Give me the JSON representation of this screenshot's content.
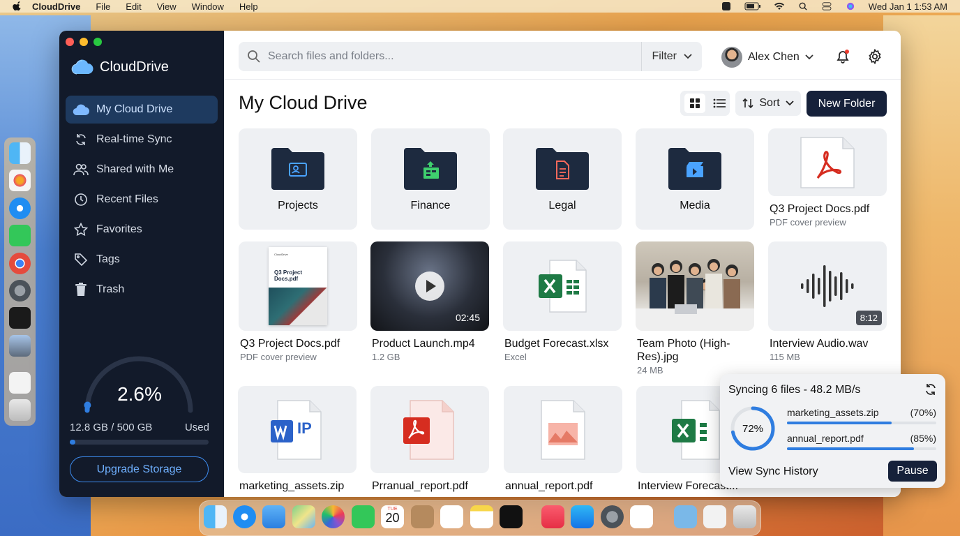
{
  "menubar": {
    "app_name": "CloudDrive",
    "menus": [
      "File",
      "Edit",
      "View",
      "Window",
      "Help"
    ],
    "clock": "Wed Jan 1  1:53 AM"
  },
  "sidebar": {
    "brand": "CloudDrive",
    "items": [
      {
        "label": "My Cloud Drive",
        "icon": "cloud-icon",
        "active": true
      },
      {
        "label": "Real-time Sync",
        "icon": "sync-icon"
      },
      {
        "label": "Shared with Me",
        "icon": "users-icon"
      },
      {
        "label": "Recent Files",
        "icon": "clock-icon"
      },
      {
        "label": "Favorites",
        "icon": "star-icon"
      },
      {
        "label": "Tags",
        "icon": "tag-icon"
      },
      {
        "label": "Trash",
        "icon": "trash-icon"
      }
    ],
    "storage": {
      "percent": "2.6%",
      "percent_value": 2.6,
      "used": "12.8 GB",
      "separator": "/",
      "total": "500 GB",
      "used_label": "Used",
      "upgrade_label": "Upgrade Storage"
    }
  },
  "header": {
    "search_placeholder": "Search files and folders...",
    "filter_label": "Filter",
    "user_name": "Alex Chen"
  },
  "main": {
    "title": "My Cloud Drive",
    "sort_label": "Sort",
    "new_folder_label": "New Folder",
    "folders": [
      {
        "name": "Projects",
        "icon": "folder-person-icon",
        "accent": "#4aa3ff"
      },
      {
        "name": "Finance",
        "icon": "folder-finance-icon",
        "accent": "#3fcf6e"
      },
      {
        "name": "Legal",
        "icon": "folder-document-icon",
        "accent": "#ff6a5c"
      },
      {
        "name": "Media",
        "icon": "folder-media-icon",
        "accent": "#4aa3ff"
      }
    ],
    "files_row1": [
      {
        "name": "Q3 Project Docs.pdf",
        "sub": "PDF cover preview",
        "icon": "pdf-icon"
      }
    ],
    "files_row2": [
      {
        "name": "Q3 Project Docs.pdf",
        "sub": "PDF cover preview",
        "cover_title": "Q3 Project Docs.pdf",
        "cover_brand": "CloudDrive"
      },
      {
        "name": "Product Launch.mp4",
        "sub": "1.2 GB",
        "duration": "02:45"
      },
      {
        "name": "Budget Forecast.xlsx",
        "sub": "Excel"
      },
      {
        "name": "Team Photo (High-Res).jpg",
        "sub": "24 MB"
      },
      {
        "name": "Interview Audio.wav",
        "sub": "115 MB",
        "duration": "8:12"
      }
    ],
    "files_row3": [
      {
        "name": "marketing_assets.zip",
        "icon_text": "IP"
      },
      {
        "name": "Prranual_report.pdf"
      },
      {
        "name": "annual_report.pdf"
      },
      {
        "name": "Interview Forecast..."
      }
    ]
  },
  "sync": {
    "title": "Syncing 6 files - 48.2 MB/s",
    "overall_pct": "72%",
    "overall_value": 72,
    "files": [
      {
        "name": "marketing_assets.zip",
        "pct": "(70%)",
        "value": 70
      },
      {
        "name": "annual_report.pdf",
        "pct": "(85%)",
        "value": 85
      }
    ],
    "history_label": "View Sync History",
    "pause_label": "Pause"
  },
  "dock_calendar": {
    "month": "TUE",
    "day": "20"
  }
}
